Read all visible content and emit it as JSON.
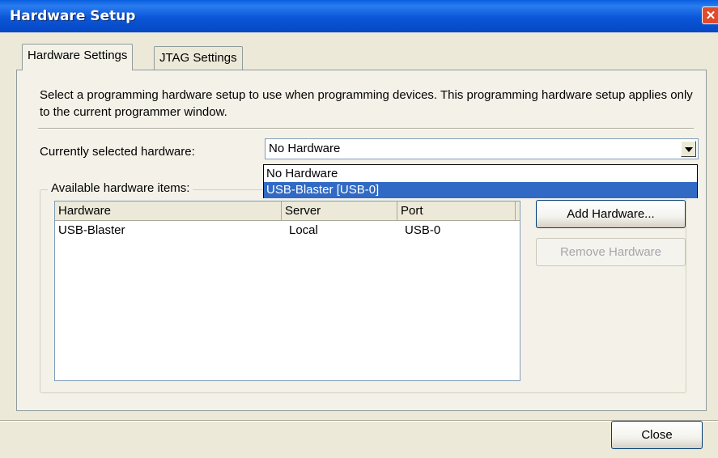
{
  "window": {
    "title": "Hardware Setup",
    "close_glyph": "✕"
  },
  "tabs": [
    {
      "label": "Hardware Settings",
      "active": true
    },
    {
      "label": "JTAG Settings",
      "active": false
    }
  ],
  "description": "Select a programming hardware setup to use when programming devices. This programming hardware setup applies only to the current programmer window.",
  "current_hardware": {
    "label": "Currently selected hardware:",
    "value": "No Hardware",
    "options": [
      "No Hardware",
      "USB-Blaster [USB-0]"
    ],
    "highlighted_option": "USB-Blaster [USB-0]"
  },
  "available": {
    "legend": "Available hardware items:",
    "columns": [
      "Hardware",
      "Server",
      "Port"
    ],
    "rows": [
      {
        "hardware": "USB-Blaster",
        "server": "Local",
        "port": "USB-0"
      }
    ]
  },
  "buttons": {
    "add": "Add Hardware...",
    "remove": "Remove Hardware",
    "close": "Close"
  },
  "colors": {
    "titlebar": "#0A56D8",
    "selection": "#316AC5",
    "face": "#ECE9D8"
  },
  "icons": {
    "close": "close-icon",
    "dropdown": "chevron-down-icon"
  }
}
